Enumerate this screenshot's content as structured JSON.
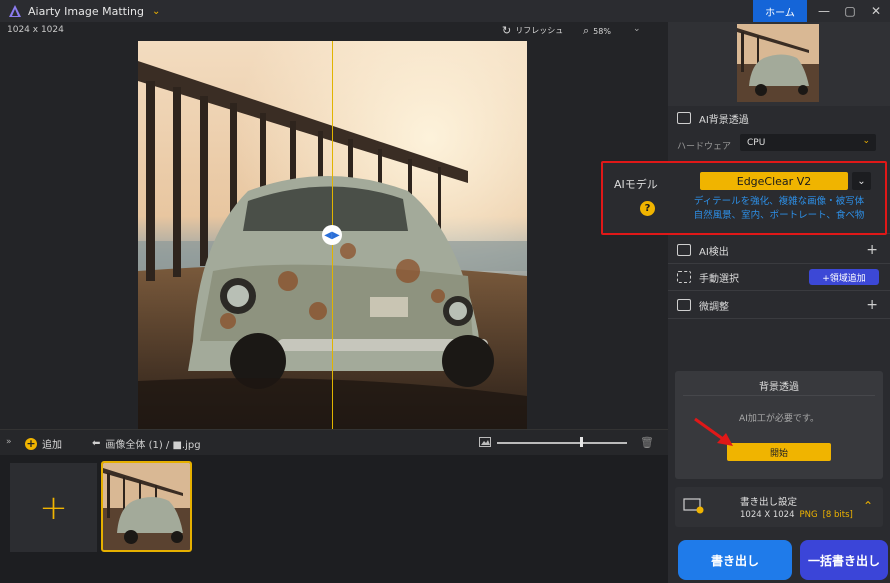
{
  "app": {
    "title": "Aiarty Image Matting",
    "home_label": "ホーム"
  },
  "canvas": {
    "dimensions": "1024 x 1024",
    "refresh_label": "リフレッシュ",
    "zoom": "58%"
  },
  "toolbar": {
    "add_label": "追加",
    "breadcrumb": "画像全体 (1) / ■.jpg"
  },
  "sidebar": {
    "bg_removal_title": "AI背景透過",
    "hardware_label": "ハードウェア",
    "hardware_value": "CPU",
    "model_label": "AIモデル",
    "model_value": "EdgeClear V2",
    "model_desc_line1": "ディテールを強化、複雑な画像・被写体",
    "model_desc_line2": "自然風景、室内、ポートレート、食べ物",
    "ai_detect_label": "AI検出",
    "manual_select_label": "手動選択",
    "region_add_label": "+領域追加",
    "fine_tune_label": "微調整",
    "bg_panel_title": "背景透過",
    "bg_panel_message": "AI加工が必要です。",
    "start_label": "開始",
    "export_settings_title": "書き出し設定",
    "export_size": "1024 X 1024",
    "export_format": "PNG",
    "export_bits": "[8 bits]",
    "export_label": "書き出し",
    "batch_export_label": "一括書き出し"
  },
  "colors": {
    "accent": "#f0b400",
    "blue": "#1f7bea",
    "highlight": "#e01818"
  }
}
